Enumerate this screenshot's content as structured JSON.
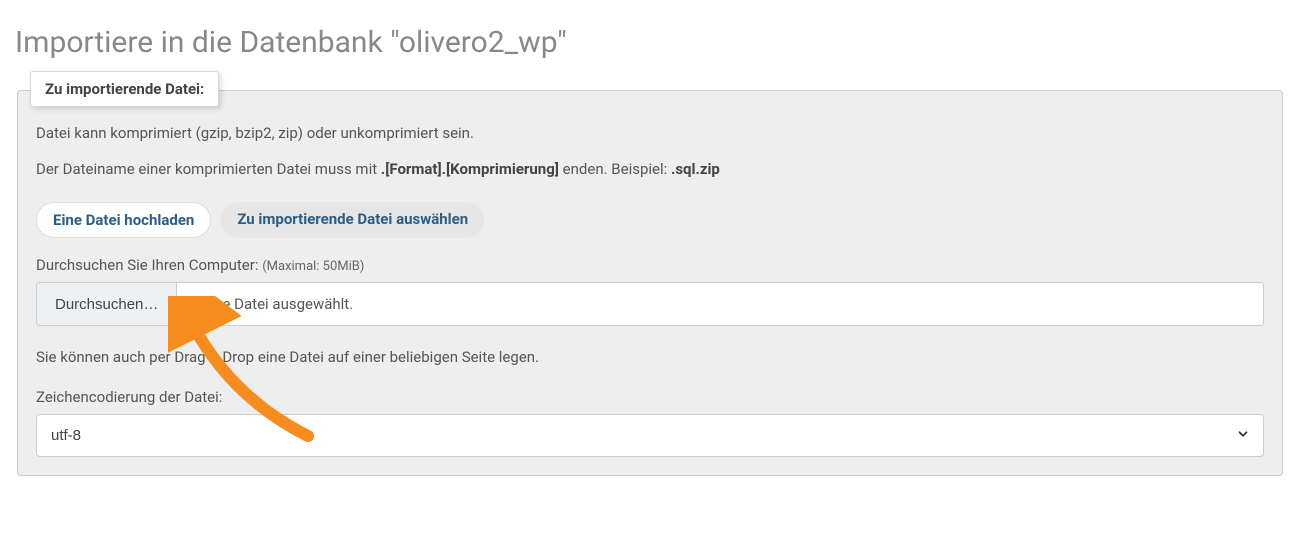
{
  "header": {
    "title": "Importiere in die Datenbank \"olivero2_wp\""
  },
  "fieldset": {
    "legend": "Zu importierende Datei:",
    "help1_pre": "Datei kann komprimiert (gzip, bzip2, zip) oder unkomprimiert sein.",
    "help2_pre": "Der Dateiname einer komprimierten Datei muss mit ",
    "help2_mid": ".[Format].[Komprimierung]",
    "help2_post": " enden. Beispiel: ",
    "help2_example": ".sql.zip",
    "tabs": {
      "upload": "Eine Datei hochladen",
      "select": "Zu importierende Datei auswählen"
    },
    "browse_label_pre": "Durchsuchen Sie Ihren Computer: ",
    "browse_label_small": "(Maximal: 50MiB)",
    "browse_button": "Durchsuchen…",
    "file_status": "Keine Datei ausgewählt.",
    "drag_note": "Sie können auch per Drag & Drop eine Datei auf einer beliebigen Seite legen.",
    "enc_label": "Zeichencodierung der Datei:",
    "enc_value": "utf-8"
  }
}
